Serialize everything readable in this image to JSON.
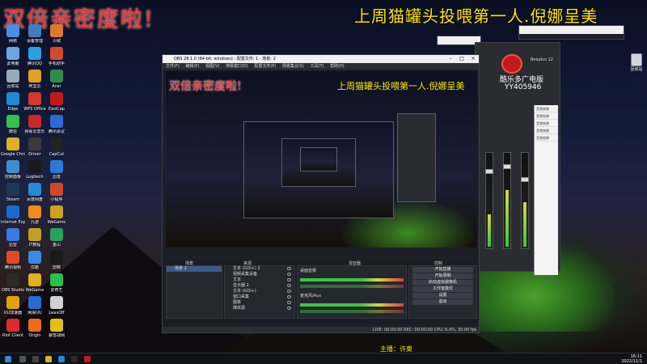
{
  "overlay": {
    "left_text": "双倍亲密度啦!",
    "right_text": "上周猫罐头投喂第一人.倪娜呈美"
  },
  "desktop_icons": [
    {
      "label": "网络",
      "color": "#4a90e2"
    },
    {
      "label": "设备管理",
      "color": "#3f7fc0"
    },
    {
      "label": "火绒",
      "color": "#e07a2a"
    },
    {
      "label": "此电脑",
      "color": "#6aa7e0"
    },
    {
      "label": "腾讯QQ",
      "color": "#2aa0e0"
    },
    {
      "label": "手机助手",
      "color": "#d14b2b"
    },
    {
      "label": "回收站",
      "color": "#9aa9bb"
    },
    {
      "label": "阿里云",
      "color": "#e0a020"
    },
    {
      "label": "Acer",
      "color": "#2a8f4a"
    },
    {
      "label": "Edge",
      "color": "#1e8ad6"
    },
    {
      "label": "WPS Office",
      "color": "#d23a2a"
    },
    {
      "label": "EasiCap",
      "color": "#c01a1a"
    },
    {
      "label": "微信",
      "color": "#34c04a"
    },
    {
      "label": "网易云音乐",
      "color": "#c82a2a"
    },
    {
      "label": "腾讯会议",
      "color": "#2a6ad6"
    },
    {
      "label": "Google Chrome",
      "color": "#e0b020"
    },
    {
      "label": "Driver",
      "color": "#3a3a3a"
    },
    {
      "label": "CapCut",
      "color": "#222"
    },
    {
      "label": "控制面板",
      "color": "#3f8fcf"
    },
    {
      "label": "Logitech",
      "color": "#1a1a1a"
    },
    {
      "label": "迅雷",
      "color": "#2a7ad6"
    },
    {
      "label": "Steam",
      "color": "#1a3a5a"
    },
    {
      "label": "百度网盘",
      "color": "#2a8ad6"
    },
    {
      "label": "小程序",
      "color": "#d04a2a"
    },
    {
      "label": "Internet Explorer",
      "color": "#1a6ad0"
    },
    {
      "label": "九游",
      "color": "#f08a1a"
    },
    {
      "label": "WeGame",
      "color": "#d0a020"
    },
    {
      "label": "迅雷",
      "color": "#3a7ae0"
    },
    {
      "label": "IT教程",
      "color": "#c0a020"
    },
    {
      "label": "金山",
      "color": "#2aa05a"
    },
    {
      "label": "腾讯视频",
      "color": "#e04a2a"
    },
    {
      "label": "优酷",
      "color": "#3a8ae0"
    },
    {
      "label": "剪映",
      "color": "#1a1a1a"
    },
    {
      "label": "OBS Studio",
      "color": "#2a2a2a"
    },
    {
      "label": "WeGame",
      "color": "#e0b020"
    },
    {
      "label": "爱奇艺",
      "color": "#2ac04a"
    },
    {
      "label": "UU加速器",
      "color": "#e0a010"
    },
    {
      "label": "网易UU",
      "color": "#2a6ad6"
    },
    {
      "label": "LeavOff",
      "color": "#d0d0d0"
    },
    {
      "label": "Riot Client",
      "color": "#e02a2a"
    },
    {
      "label": "Origin",
      "color": "#f06a1a"
    },
    {
      "label": "暴雪战网",
      "color": "#e0c01a"
    }
  ],
  "recycle": {
    "label": "回收站"
  },
  "obs": {
    "title": "OBS 28.1.0 (64-bit, windows) - 配置文件: 1 - 场景: 2",
    "menu": [
      "文件(F)",
      "编辑(E)",
      "视图(V)",
      "停靠窗口(D)",
      "配置文件(P)",
      "场景集合(S)",
      "工具(T)",
      "帮助(H)"
    ],
    "preview_left": "双倍亲密度啦!",
    "preview_right": "上周猫罐头投喂第一人.倪娜呈美",
    "dock_scenes": "场景",
    "dock_sources": "来源",
    "dock_mixer": "混音器",
    "dock_controls": "控制",
    "scene_items": [
      "场景 2"
    ],
    "source_items": [
      "文本 (GDI+) 2",
      "视频采集设备",
      "文本",
      "显示器 2",
      "文本 (GDI+)",
      "窗口采集",
      "图像",
      "媒体源"
    ],
    "mixer_channels": [
      "桌面音频",
      "麦克风/Aux"
    ],
    "controls": [
      "开始直播",
      "开始录制",
      "启动虚拟摄像机",
      "工作室模式",
      "设置",
      "退出"
    ],
    "status": "LIVE: 00:00:00   REC: 00:00:00   CPU: 6.4%, 30.00 fps"
  },
  "mixer_app": {
    "name": "酷乐多广电版",
    "id": "YY405946",
    "version": "Beeplus 12"
  },
  "side_panel": [
    "音频效果",
    "音频效果",
    "音频效果",
    "音频效果",
    "音频效果"
  ],
  "subtitle": "主播：许東",
  "taskbar": {
    "time": "16:11",
    "date": "2022/11/1"
  }
}
